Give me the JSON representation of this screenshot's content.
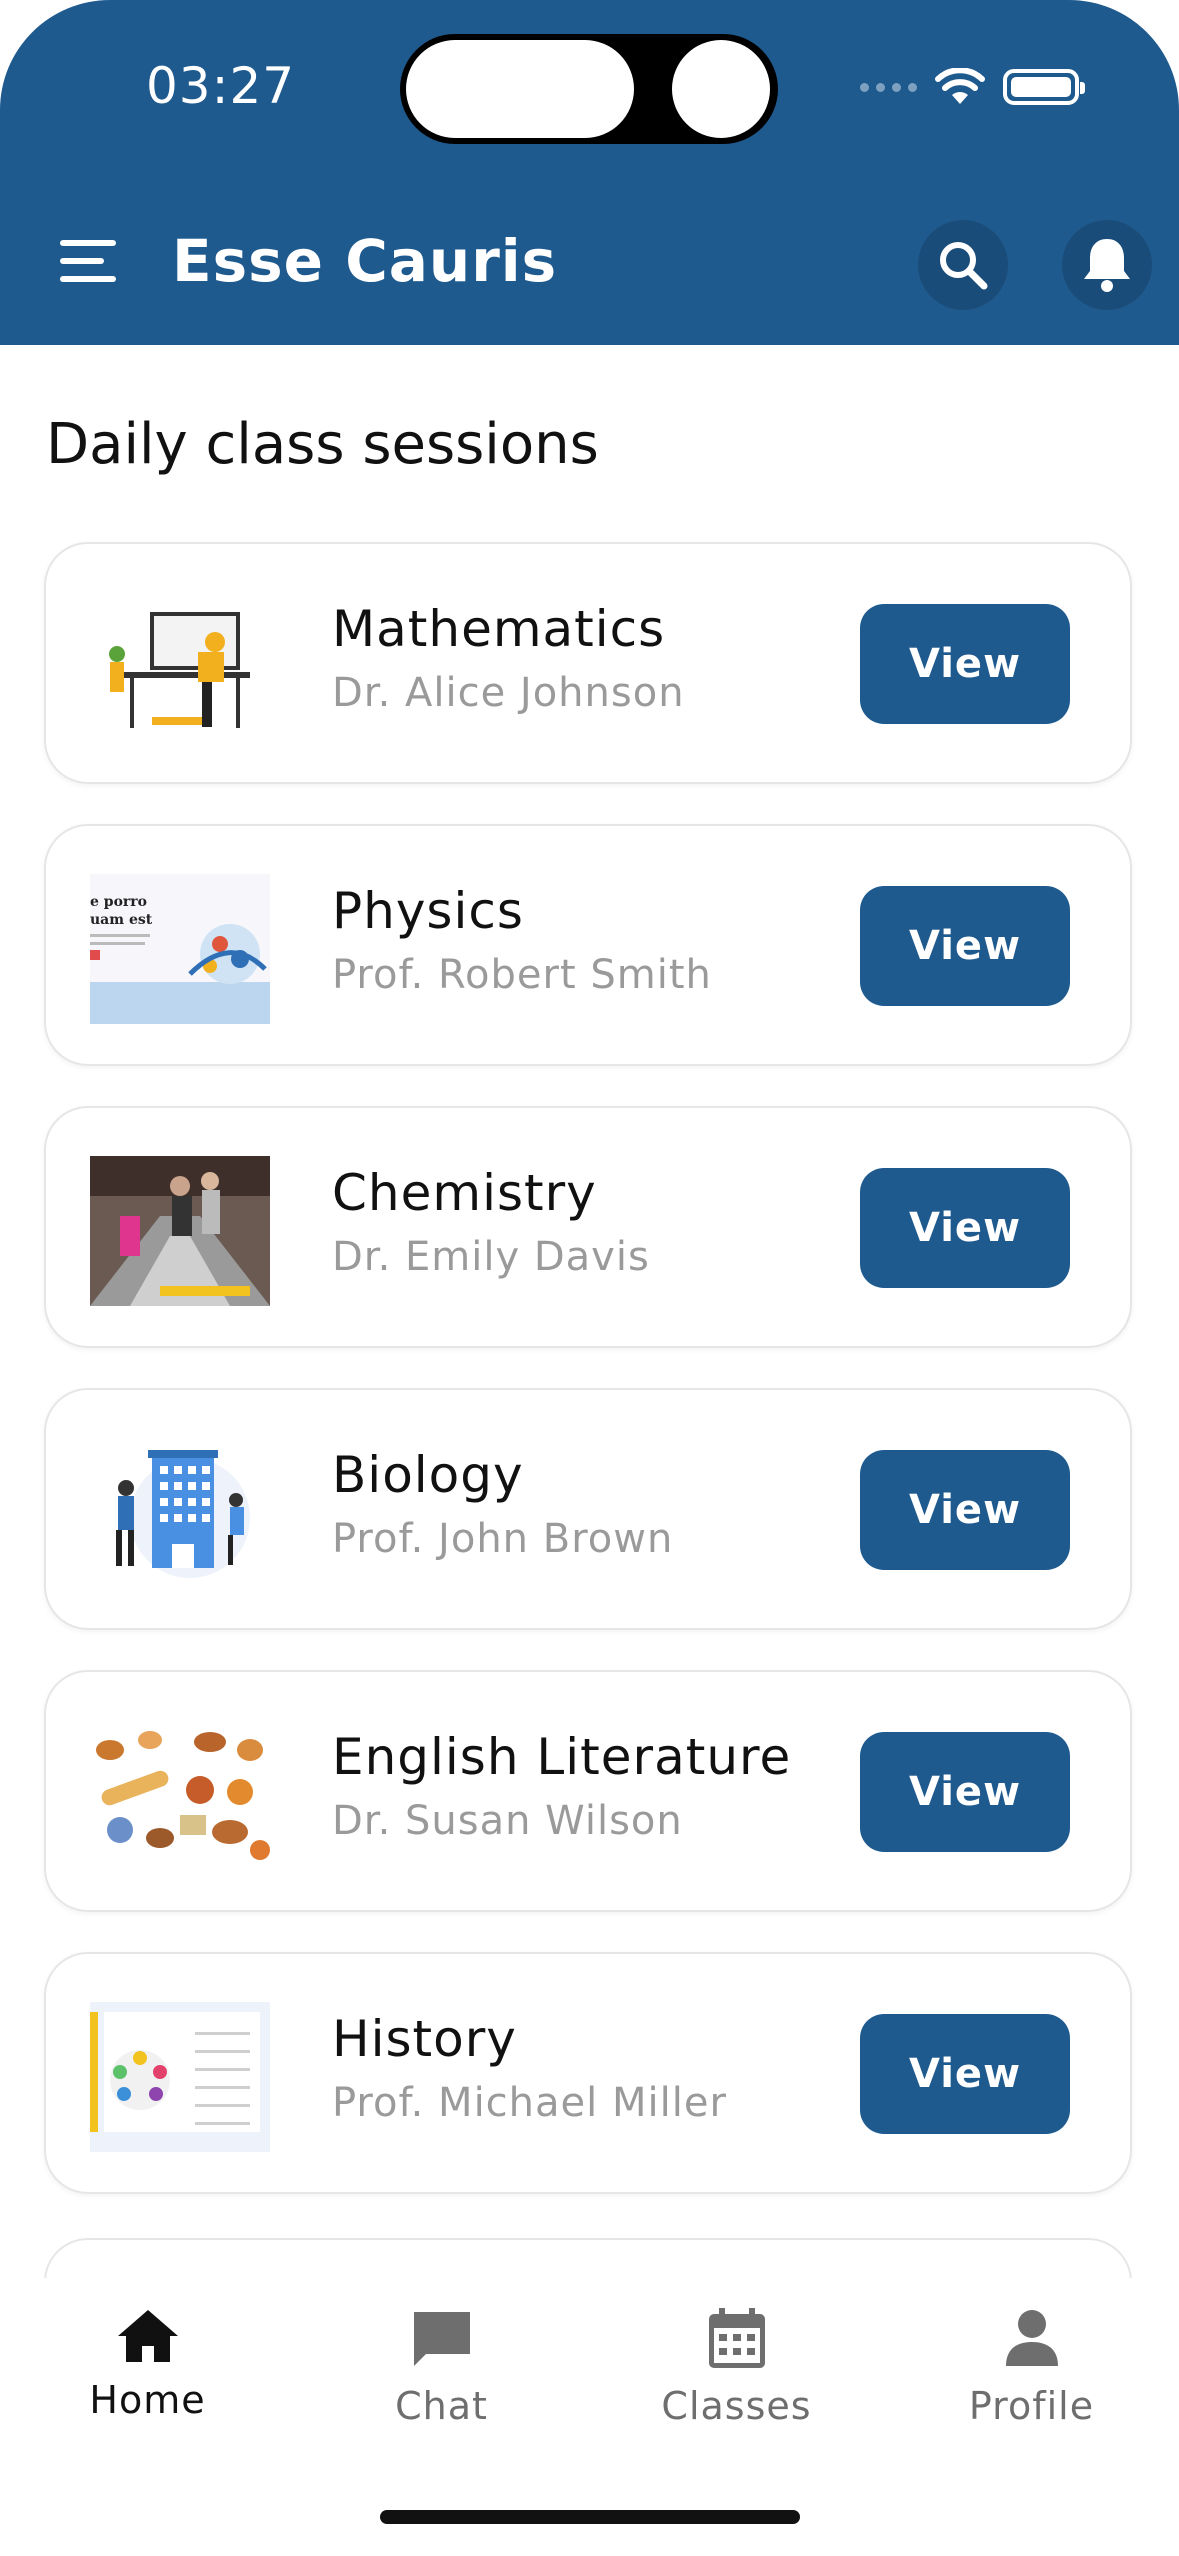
{
  "status_bar": {
    "time": "03:27"
  },
  "header": {
    "title": "Esse Cauris",
    "menu_icon": "hamburger-menu-icon",
    "search_icon": "search-icon",
    "bell_icon": "bell-icon",
    "background": "#1f5a8f"
  },
  "section": {
    "title": "Daily class sessions"
  },
  "classes": [
    {
      "subject": "Mathematics",
      "teacher": "Dr. Alice Johnson",
      "button": "View"
    },
    {
      "subject": "Physics",
      "teacher": "Prof. Robert Smith",
      "button": "View"
    },
    {
      "subject": "Chemistry",
      "teacher": "Dr. Emily Davis",
      "button": "View"
    },
    {
      "subject": "Biology",
      "teacher": "Prof. John Brown",
      "button": "View"
    },
    {
      "subject": "English Literature",
      "teacher": "Dr. Susan Wilson",
      "button": "View"
    },
    {
      "subject": "History",
      "teacher": "Prof. Michael Miller",
      "button": "View"
    }
  ],
  "bottom_nav": [
    {
      "label": "Home",
      "icon": "home-icon",
      "active": true
    },
    {
      "label": "Chat",
      "icon": "chat-icon",
      "active": false
    },
    {
      "label": "Classes",
      "icon": "calendar-icon",
      "active": false
    },
    {
      "label": "Profile",
      "icon": "person-icon",
      "active": false
    }
  ],
  "colors": {
    "primary": "#1f5a8f",
    "nav_active": "#111111",
    "nav_inactive": "#6e6e6e"
  }
}
